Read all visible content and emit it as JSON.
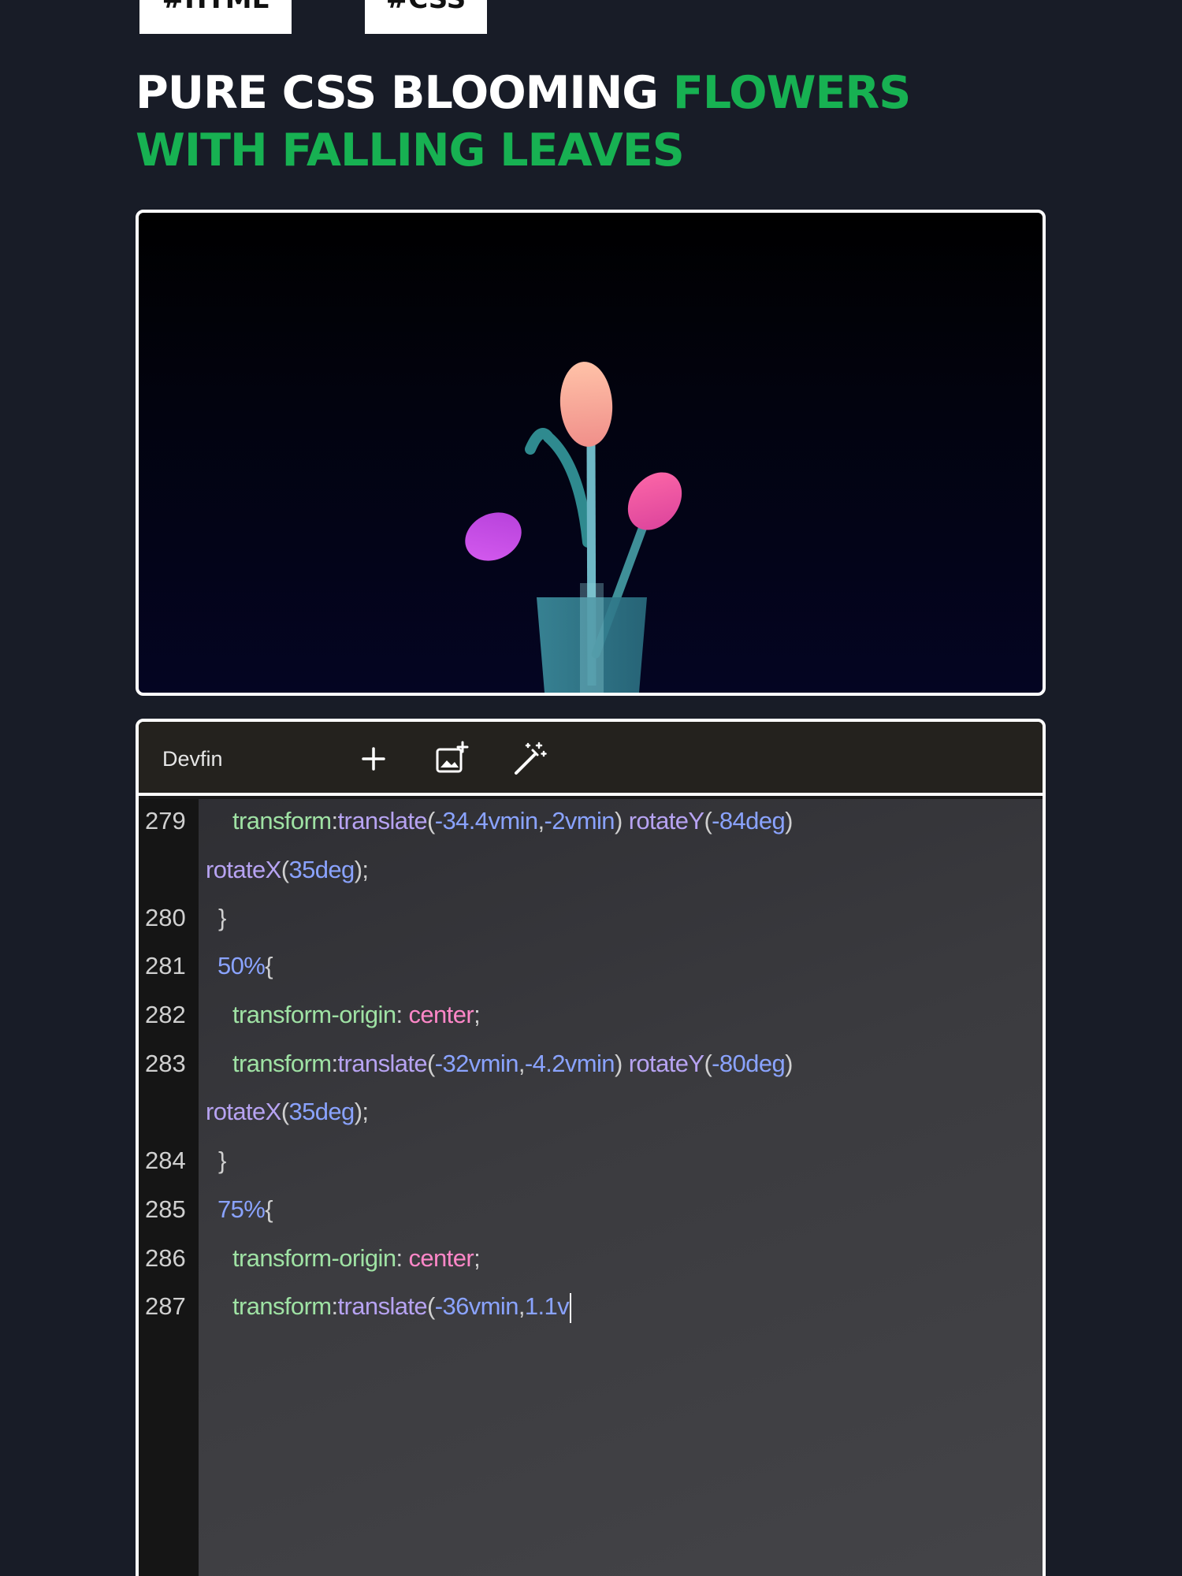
{
  "tags": [
    "#HTML",
    "#CSS"
  ],
  "title": {
    "line1_white": "PURE CSS BLOOMING ",
    "line1_green": "FLOWERS",
    "line2_green": "WITH FALLING LEAVES"
  },
  "colors": {
    "background": "#181c27",
    "accent_green": "#17b152",
    "css_property": "#9fe2a4",
    "css_function": "#b7a3f2",
    "css_number": "#8aa3ff",
    "css_keyword": "#ff87c8"
  },
  "editor": {
    "brand": "Devfin",
    "toolbar_icons": [
      "plus-icon",
      "add-image-icon",
      "magic-wand-icon"
    ],
    "lines": [
      {
        "number": "279",
        "segments": [
          {
            "t": "transform",
            "c": "p"
          },
          {
            "t": ":",
            "c": "d"
          },
          {
            "t": "translate",
            "c": "f"
          },
          {
            "t": "(",
            "c": "d"
          },
          {
            "t": "-34.4vmin",
            "c": "n"
          },
          {
            "t": ",",
            "c": "d"
          },
          {
            "t": "-2vmin",
            "c": "n"
          },
          {
            "t": ") ",
            "c": "d"
          },
          {
            "t": "rotateY",
            "c": "f"
          },
          {
            "t": "(",
            "c": "d"
          },
          {
            "t": "-84deg",
            "c": "n"
          },
          {
            "t": ")",
            "c": "d"
          }
        ]
      },
      {
        "number": "",
        "segments": [
          {
            "t": "rotateX",
            "c": "f"
          },
          {
            "t": "(",
            "c": "d"
          },
          {
            "t": "35deg",
            "c": "n"
          },
          {
            "t": ");",
            "c": "d"
          }
        ]
      },
      {
        "number": "280",
        "segments": [
          {
            "t": "}",
            "c": "d"
          }
        ]
      },
      {
        "number": "281",
        "segments": [
          {
            "t": "50%",
            "c": "n"
          },
          {
            "t": "{",
            "c": "d"
          }
        ]
      },
      {
        "number": "282",
        "segments": [
          {
            "t": "transform-origin",
            "c": "p"
          },
          {
            "t": ": ",
            "c": "d"
          },
          {
            "t": "center",
            "c": "k"
          },
          {
            "t": ";",
            "c": "d"
          }
        ]
      },
      {
        "number": "283",
        "segments": [
          {
            "t": "transform",
            "c": "p"
          },
          {
            "t": ":",
            "c": "d"
          },
          {
            "t": "translate",
            "c": "f"
          },
          {
            "t": "(",
            "c": "d"
          },
          {
            "t": "-32vmin",
            "c": "n"
          },
          {
            "t": ",",
            "c": "d"
          },
          {
            "t": "-4.2vmin",
            "c": "n"
          },
          {
            "t": ") ",
            "c": "d"
          },
          {
            "t": "rotateY",
            "c": "f"
          },
          {
            "t": "(",
            "c": "d"
          },
          {
            "t": "-80deg",
            "c": "n"
          },
          {
            "t": ")",
            "c": "d"
          }
        ]
      },
      {
        "number": "",
        "segments": [
          {
            "t": "rotateX",
            "c": "f"
          },
          {
            "t": "(",
            "c": "d"
          },
          {
            "t": "35deg",
            "c": "n"
          },
          {
            "t": ");",
            "c": "d"
          }
        ]
      },
      {
        "number": "284",
        "segments": [
          {
            "t": "}",
            "c": "d"
          }
        ]
      },
      {
        "number": "285",
        "segments": [
          {
            "t": "75%",
            "c": "n"
          },
          {
            "t": "{",
            "c": "d"
          }
        ]
      },
      {
        "number": "286",
        "segments": [
          {
            "t": "transform-origin",
            "c": "p"
          },
          {
            "t": ": ",
            "c": "d"
          },
          {
            "t": "center",
            "c": "k"
          },
          {
            "t": ";",
            "c": "d"
          }
        ]
      },
      {
        "number": "287",
        "segments": [
          {
            "t": "transform",
            "c": "p"
          },
          {
            "t": ":",
            "c": "d"
          },
          {
            "t": "translate",
            "c": "f"
          },
          {
            "t": "(",
            "c": "d"
          },
          {
            "t": "-36vmin",
            "c": "n"
          },
          {
            "t": ",",
            "c": "d"
          },
          {
            "t": "1.1v",
            "c": "n"
          }
        ],
        "cursor": true
      }
    ]
  }
}
